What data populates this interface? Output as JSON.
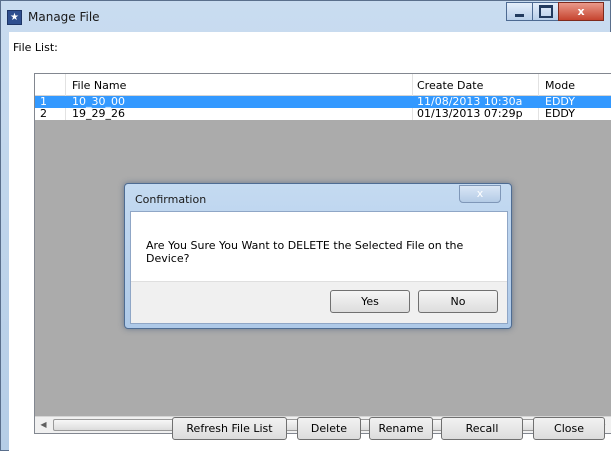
{
  "window": {
    "title": "Manage File",
    "app_icon": "app-star-icon",
    "close_glyph": "x"
  },
  "file_list": {
    "label": "File List:",
    "columns": [
      "File Name",
      "Create Date",
      "Mode"
    ],
    "rows": [
      {
        "index": "1",
        "file_name": "10_30_00",
        "create_date": "11/08/2013 10:30a",
        "mode": "EDDY",
        "selected": true
      },
      {
        "index": "2",
        "file_name": "19_29_26",
        "create_date": "01/13/2013 07:29p",
        "mode": "EDDY",
        "selected": false
      }
    ],
    "scroll_thumb_glyph": "III"
  },
  "buttons": {
    "refresh": "Refresh File List",
    "delete": "Delete",
    "rename": "Rename",
    "recall": "Recall",
    "close": "Close"
  },
  "dialog": {
    "title": "Confirmation",
    "close_glyph": "x",
    "message": "Are You Sure You Want to DELETE the Selected File on the Device?",
    "yes_label": "Yes",
    "no_label": "No"
  },
  "colors": {
    "selection": "#3399ff",
    "grid_background": "#ababab"
  }
}
